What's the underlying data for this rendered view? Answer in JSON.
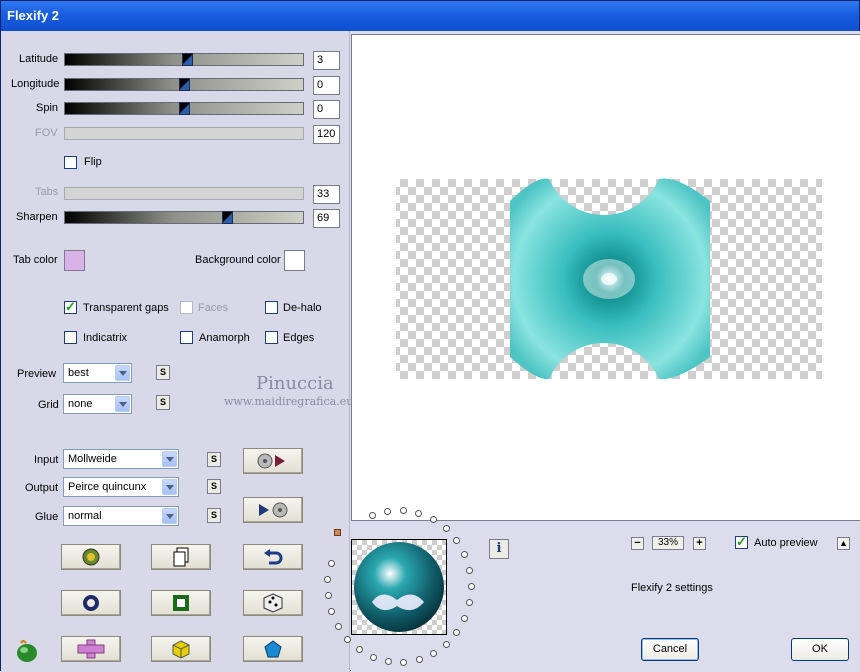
{
  "window": {
    "title": "Flexify 2"
  },
  "sliders": [
    {
      "key": "latitude",
      "label": "Latitude",
      "value": "3",
      "level": 0.51,
      "enabled": true
    },
    {
      "key": "longitude",
      "label": "Longitude",
      "value": "0",
      "level": 0.5,
      "enabled": true
    },
    {
      "key": "spin",
      "label": "Spin",
      "value": "0",
      "level": 0.5,
      "enabled": true
    },
    {
      "key": "fov",
      "label": "FOV",
      "value": "120",
      "enabled": false
    },
    {
      "key": "tabs",
      "label": "Tabs",
      "value": "33",
      "enabled": false
    },
    {
      "key": "sharpen",
      "label": "Sharpen",
      "value": "69",
      "level": 0.69,
      "enabled": true
    }
  ],
  "flip": {
    "label": "Flip",
    "checked": false
  },
  "colors": {
    "tab_color_label": "Tab color",
    "tab_color": "#d9b3e8",
    "background_color_label": "Background color",
    "background_color": "#ffffff"
  },
  "options": {
    "transparent_gaps": {
      "label": "Transparent gaps",
      "checked": true
    },
    "faces": {
      "label": "Faces",
      "checked": false,
      "enabled": false
    },
    "de_halo": {
      "label": "De-halo",
      "checked": false
    },
    "indicatrix": {
      "label": "Indicatrix",
      "checked": false
    },
    "anamorph": {
      "label": "Anamorph",
      "checked": false
    },
    "edges": {
      "label": "Edges",
      "checked": false
    }
  },
  "preview": {
    "label": "Preview",
    "value": "best"
  },
  "grid": {
    "label": "Grid",
    "value": "none"
  },
  "watermark": {
    "name": "Pinuccia",
    "url": "www.maidiregrafica.eu"
  },
  "projection": {
    "input_label": "Input",
    "input_value": "Mollweide",
    "output_label": "Output",
    "output_value": "Peirce quincunx",
    "glue_label": "Glue",
    "glue_value": "normal"
  },
  "small_button_label": "S",
  "zoom": {
    "value": "33%",
    "minus": "−",
    "plus": "+"
  },
  "auto_preview": {
    "label": "Auto preview",
    "checked": true
  },
  "settings_label": "Flexify 2 settings",
  "buttons": {
    "cancel": "Cancel",
    "ok": "OK",
    "info": "i"
  },
  "accent_colors": {
    "teal": "#3bbfbf",
    "titlebar": "#1a5de0"
  }
}
